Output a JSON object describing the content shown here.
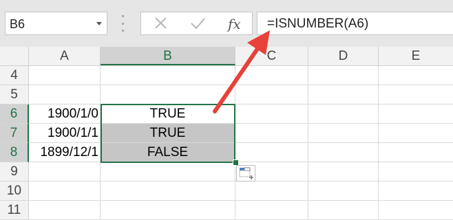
{
  "formula_bar": {
    "name_box": "B6",
    "fx_label": "fx",
    "formula": "=ISNUMBER(A6)"
  },
  "columns": [
    "A",
    "B",
    "C",
    "D",
    "E"
  ],
  "rows": [
    {
      "num": "4",
      "a": "",
      "b": ""
    },
    {
      "num": "5",
      "a": "",
      "b": ""
    },
    {
      "num": "6",
      "a": "1900/1/0",
      "b": "TRUE"
    },
    {
      "num": "7",
      "a": "1900/1/1",
      "b": "TRUE"
    },
    {
      "num": "8",
      "a": "1899/12/1",
      "b": "FALSE"
    },
    {
      "num": "9",
      "a": "",
      "b": ""
    },
    {
      "num": "10",
      "a": "",
      "b": ""
    },
    {
      "num": "11",
      "a": "",
      "b": ""
    }
  ],
  "colors": {
    "selection": "#217346",
    "annotation_arrow": "#e8413a",
    "header_bg": "#f2f2f2",
    "selected_header_bg": "#d2d2d2"
  },
  "icons": [
    "cancel-icon",
    "enter-icon",
    "quick-analysis-icon",
    "annotation-arrow"
  ]
}
